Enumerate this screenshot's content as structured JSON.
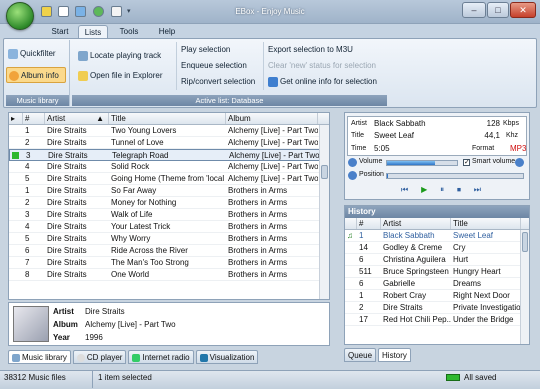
{
  "window": {
    "title": "EBox - Enjoy Music",
    "minimize": "–",
    "maximize": "□",
    "close": "✕"
  },
  "ribbon_tabs": [
    {
      "label": "Start"
    },
    {
      "label": "Lists"
    },
    {
      "label": "Tools"
    },
    {
      "label": "Help"
    }
  ],
  "ribbon": {
    "music_library": {
      "label": "Music library",
      "quickfilter": "Quickfilter",
      "album_info": "Album info"
    },
    "active_list": {
      "label": "Active list: Database",
      "locate": "Locate playing track",
      "open_explorer": "Open file in Explorer",
      "play_selection": "Play selection",
      "enqueue_selection": "Enqueue selection",
      "ripconvert": "Rip/convert selection",
      "export_m3u": "Export selection to M3U",
      "clear_new": "Clear 'new' status for selection",
      "get_online": "Get online info for selection"
    }
  },
  "tracklist": {
    "columns": [
      "#",
      "Artist",
      "Title",
      "Album"
    ],
    "sort_indicator": "▲",
    "rows": [
      {
        "num": "1",
        "artist": "Dire Straits",
        "title": "Two Young Lovers",
        "album": "Alchemy [Live] - Part Two"
      },
      {
        "num": "2",
        "artist": "Dire Straits",
        "title": "Tunnel of Love",
        "album": "Alchemy [Live] - Part Two"
      },
      {
        "num": "3",
        "artist": "Dire Straits",
        "title": "Telegraph Road",
        "album": "Alchemy [Live] - Part Two"
      },
      {
        "num": "4",
        "artist": "Dire Straits",
        "title": "Solid Rock",
        "album": "Alchemy [Live] - Part Two"
      },
      {
        "num": "5",
        "artist": "Dire Straits",
        "title": "Going Home (Theme from 'local ...",
        "album": "Alchemy [Live] - Part Two"
      },
      {
        "num": "1",
        "artist": "Dire Straits",
        "title": "So Far Away",
        "album": "Brothers in Arms"
      },
      {
        "num": "2",
        "artist": "Dire Straits",
        "title": "Money for Nothing",
        "album": "Brothers in Arms"
      },
      {
        "num": "3",
        "artist": "Dire Straits",
        "title": "Walk of Life",
        "album": "Brothers in Arms"
      },
      {
        "num": "4",
        "artist": "Dire Straits",
        "title": "Your Latest Trick",
        "album": "Brothers in Arms"
      },
      {
        "num": "5",
        "artist": "Dire Straits",
        "title": "Why Worry",
        "album": "Brothers in Arms"
      },
      {
        "num": "6",
        "artist": "Dire Straits",
        "title": "Ride Across the River",
        "album": "Brothers in Arms"
      },
      {
        "num": "7",
        "artist": "Dire Straits",
        "title": "The Man's Too Strong",
        "album": "Brothers in Arms"
      },
      {
        "num": "8",
        "artist": "Dire Straits",
        "title": "One World",
        "album": "Brothers in Arms"
      }
    ],
    "selected_index": 2
  },
  "album_info": {
    "artist_label": "Artist",
    "artist": "Dire Straits",
    "album_label": "Album",
    "album": "Alchemy [Live] - Part Two",
    "year_label": "Year",
    "year": "1996"
  },
  "bottom_tabs": [
    {
      "label": "Music library"
    },
    {
      "label": "CD player"
    },
    {
      "label": "Internet radio"
    },
    {
      "label": "Visualization"
    }
  ],
  "player": {
    "artist_label": "Artist",
    "artist": "Black Sabbath",
    "bitrate": "128",
    "bitrate_unit": "Kbps",
    "title_label": "Title",
    "title": "Sweet Leaf",
    "samplerate": "44,1",
    "samplerate_unit": "Khz",
    "time_label": "Time",
    "time": "5:05",
    "format_label": "Format",
    "format": "MP3",
    "volume_label": "Volume",
    "smart_volume_label": "Smart volume",
    "smart_volume_checked": true,
    "position_label": "Position",
    "volume_level": 0.68,
    "position_level": 0.0
  },
  "history": {
    "title": "History",
    "columns": [
      "#",
      "Artist",
      "Title"
    ],
    "rows": [
      {
        "num": "1",
        "artist": "Black Sabbath",
        "title": "Sweet Leaf",
        "playing": true
      },
      {
        "num": "14",
        "artist": "Godley & Creme",
        "title": "Cry"
      },
      {
        "num": "6",
        "artist": "Christina Aguilera",
        "title": "Hurt"
      },
      {
        "num": "511",
        "artist": "Bruce Springsteen",
        "title": "Hungry Heart"
      },
      {
        "num": "6",
        "artist": "Gabrielle",
        "title": "Dreams"
      },
      {
        "num": "1",
        "artist": "Robert Cray",
        "title": "Right Next Door"
      },
      {
        "num": "2",
        "artist": "Dire Straits",
        "title": "Private Investigatio..."
      },
      {
        "num": "17",
        "artist": "Red Hot Chili Pep...",
        "title": "Under the Bridge"
      }
    ]
  },
  "right_tabs": [
    {
      "label": "Queue"
    },
    {
      "label": "History"
    }
  ],
  "statusbar": {
    "files": "38312 Music files",
    "selected": "1 item selected",
    "saved": "All saved"
  },
  "colors": {
    "accent": "#2f5f9f",
    "playing": "#1a7a1a",
    "format": "#d01010"
  }
}
